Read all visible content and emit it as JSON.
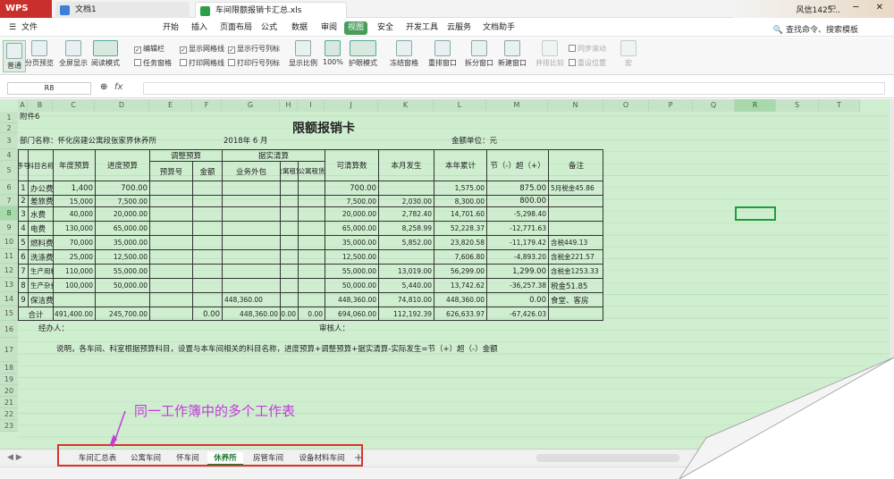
{
  "app": {
    "logo": "WPS",
    "tabs": [
      {
        "label": "文档1"
      },
      {
        "label": "车间限额报销卡汇总.xls"
      }
    ],
    "user": "风信1425..."
  },
  "menu": {
    "file": "文件",
    "items": [
      "开始",
      "插入",
      "页面布局",
      "公式",
      "数据",
      "审阅",
      "视图",
      "安全",
      "开发工具",
      "云服务",
      "文档助手"
    ],
    "active_index": 6,
    "search": "查找命令、搜索模板"
  },
  "ribbon": {
    "buttons": [
      "普通",
      "分页预览",
      "全屏显示",
      "阅读模式",
      "显示比例",
      "100%",
      "护眼模式",
      "冻结窗格",
      "重排窗口",
      "拆分窗口",
      "新建窗口",
      "并排比较",
      "重设位置",
      "宏"
    ],
    "checks": [
      {
        "label": "编辑栏",
        "on": true
      },
      {
        "label": "显示网格线",
        "on": true
      },
      {
        "label": "显示行号列标",
        "on": true
      },
      {
        "label": "任务窗格",
        "on": false
      },
      {
        "label": "打印网格线",
        "on": false
      },
      {
        "label": "打印行号列标",
        "on": false
      }
    ],
    "sync_scroll": "同步滚动"
  },
  "formula": {
    "name_box": "R8",
    "fx": "fx",
    "value": ""
  },
  "columns": [
    "A",
    "B",
    "C",
    "D",
    "E",
    "F",
    "G",
    "H",
    "I",
    "J",
    "K",
    "L",
    "M",
    "N",
    "O",
    "P",
    "Q",
    "R",
    "S",
    "T"
  ],
  "selected_col": "R",
  "selected_row": "8",
  "rows": [
    "1",
    "2",
    "3",
    "4",
    "5",
    "6",
    "7",
    "8",
    "9",
    "10",
    "11",
    "12",
    "13",
    "14",
    "15",
    "16",
    "17",
    "18",
    "19",
    "20",
    "21",
    "22",
    "23"
  ],
  "sheet": {
    "attachment": "附件6",
    "title": "限额报销卡",
    "dept": "部门名称：怀化房建公寓段张家界休养所",
    "period": "2018年 6 月",
    "unit": "金额单位：元",
    "headers": {
      "seq": "序号",
      "subject": "科目名称",
      "annual": "年度预算",
      "progress": "进度预算",
      "adjust": "调整预算",
      "adj_no": "预算号",
      "adj_amt": "金额",
      "actual": "据实清算",
      "biz": "业务外包",
      "apt1": "公寓租赁",
      "apt2": "公寓租赁",
      "avail": "可清算数",
      "month": "本月发生",
      "ytd": "本年累计",
      "save": "节（-）超（+）",
      "note": "备注"
    },
    "data": [
      {
        "seq": "1",
        "name": "办公费",
        "annual": "1,400",
        "progress": "700.00",
        "avail": "700.00",
        "month": "",
        "ytd": "1,575.00",
        "save": "875.00",
        "note": "5月税金45.86"
      },
      {
        "seq": "2",
        "name": "差旅费",
        "annual": "15,000",
        "progress": "7,500.00",
        "avail": "7,500.00",
        "month": "2,030.00",
        "ytd": "8,300.00",
        "save": "800.00",
        "note": ""
      },
      {
        "seq": "3",
        "name": "水费",
        "annual": "40,000",
        "progress": "20,000.00",
        "avail": "20,000.00",
        "month": "2,782.40",
        "ytd": "14,701.60",
        "save": "-5,298.40",
        "note": ""
      },
      {
        "seq": "4",
        "name": "电费",
        "annual": "130,000",
        "progress": "65,000.00",
        "avail": "65,000.00",
        "month": "8,258.99",
        "ytd": "52,228.37",
        "save": "-12,771.63",
        "note": ""
      },
      {
        "seq": "5",
        "name": "燃料费",
        "annual": "70,000",
        "progress": "35,000.00",
        "avail": "35,000.00",
        "month": "5,852.00",
        "ytd": "23,820.58",
        "save": "-11,179.42",
        "note": "含税449.13"
      },
      {
        "seq": "6",
        "name": "洗涤费",
        "annual": "25,000",
        "progress": "12,500.00",
        "avail": "12,500.00",
        "month": "",
        "ytd": "7,606.80",
        "save": "-4,893.20",
        "note": "含税金221.57"
      },
      {
        "seq": "7",
        "name": "生产用料",
        "annual": "110,000",
        "progress": "55,000.00",
        "avail": "55,000.00",
        "month": "13,019.00",
        "ytd": "56,299.00",
        "save": "1,299.00",
        "note": "含税金1253.33"
      },
      {
        "seq": "8",
        "name": "生产杂费",
        "annual": "100,000",
        "progress": "50,000.00",
        "avail": "50,000.00",
        "month": "5,440.00",
        "ytd": "13,742.62",
        "save": "-36,257.38",
        "note": "税金51.85"
      },
      {
        "seq": "9",
        "name": "保洁费",
        "annual": "",
        "progress": "",
        "biz": "448,360.00",
        "avail": "448,360.00",
        "month": "74,810.00",
        "ytd": "448,360.00",
        "save": "0.00",
        "note": "食堂、客房"
      }
    ],
    "total": {
      "label": "合计",
      "annual": "491,400.00",
      "progress": "245,700.00",
      "adj_amt": "0.00",
      "biz": "448,360.00",
      "apt1": "0.00",
      "apt2": "0.00",
      "avail": "694,060.00",
      "month": "112,192.39",
      "ytd": "626,633.97",
      "save": "-67,426.03"
    },
    "handler": "经办人：",
    "reviewer": "审核人：",
    "note": "说明，各车间、科室根据预算科目，设置与本车间相关的科目名称，进度预算+调整预算+据实清算-实际发生=节（+）超（-）金额"
  },
  "sheet_tabs": [
    "车间汇总表",
    "公寓车间",
    "怀车间",
    "休养所",
    "房管车间",
    "设备材料车间"
  ],
  "active_sheet": 3,
  "annotation": "同一工作簿中的多个工作表"
}
